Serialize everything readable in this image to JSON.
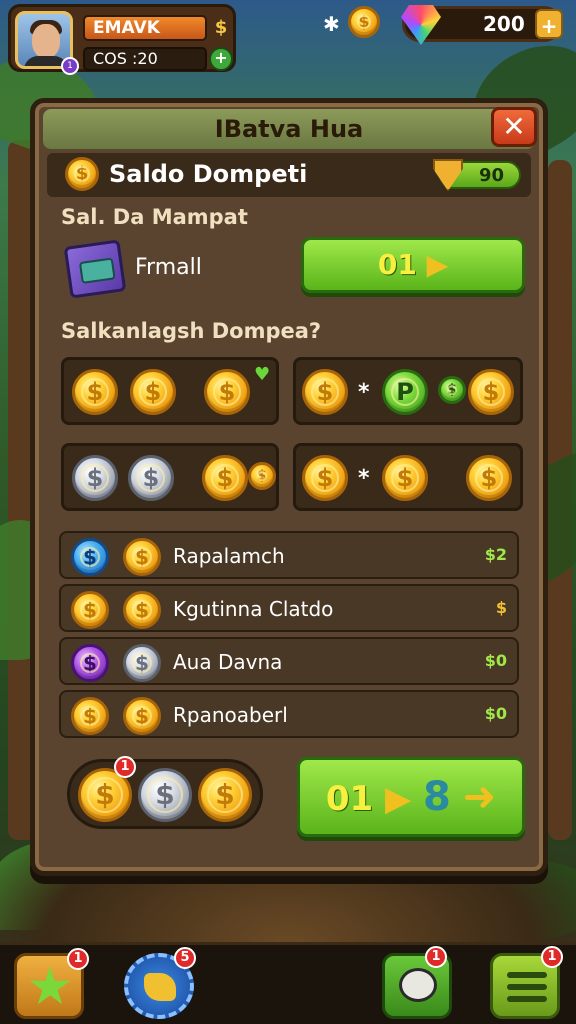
{
  "hud": {
    "player_name": "EMAVK",
    "cost_label": "COS :20",
    "name_plus": "$",
    "cost_plus": "+",
    "avatar_badge": "1",
    "sparkle": "✱",
    "coin_glyph": "$",
    "gem_value": "200",
    "gem_plus": "+"
  },
  "panel": {
    "title": "IBatva Hua",
    "close": "✕",
    "balance": {
      "title": "Saldo Dompeti",
      "coin_glyph": "$",
      "value": "90"
    },
    "section1_label": "Sal. Da Mampat",
    "item": {
      "name": "Frmall",
      "button_value": "01",
      "button_arrow": "▶"
    },
    "section2_label": "Salkanlagsh Dompea?",
    "tiles": [
      {
        "coins": [
          "$",
          "$",
          "$"
        ],
        "extra": "♥"
      },
      {
        "coins": [
          "$",
          "P",
          "$"
        ],
        "cross": "*",
        "extra": "$"
      },
      {
        "coins": [
          "$",
          "$",
          "$",
          "$"
        ]
      },
      {
        "coins": [
          "$",
          "$",
          "$"
        ],
        "cross": "*"
      }
    ],
    "list": [
      {
        "label": "Rapalamch",
        "value": "$2"
      },
      {
        "label": "Kgutinna Clatdo",
        "value": "$"
      },
      {
        "label": "Aua Davna",
        "value": "$0"
      },
      {
        "label": "Rpanoaberl",
        "value": "$0"
      }
    ],
    "bottom_coins": {
      "glyph": "$",
      "badge": "1"
    },
    "confirm": {
      "value": "01",
      "arrow": "▶",
      "amount": "8",
      "big_arrow": "➜"
    }
  },
  "nav": {
    "star_badge": "1",
    "gear_badge": "5",
    "chat_badge": "1",
    "menu_badge": "1"
  },
  "colors": {
    "panel_bg": "#5a4430",
    "accent_green": "#5ab41a",
    "accent_gold": "#ffd23a",
    "close_red": "#c83a1a"
  }
}
